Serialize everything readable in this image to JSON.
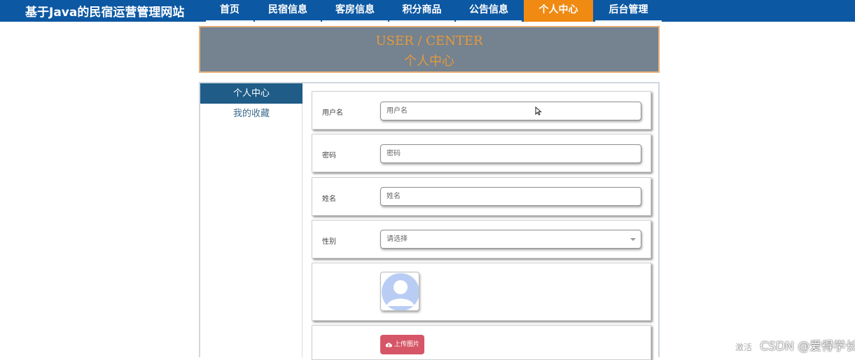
{
  "header": {
    "site_title": "基于Java的民宿运营管理网站",
    "nav": [
      {
        "label": "首页"
      },
      {
        "label": "民宿信息"
      },
      {
        "label": "客房信息"
      },
      {
        "label": "积分商品"
      },
      {
        "label": "公告信息"
      },
      {
        "label": "个人中心",
        "active": true
      },
      {
        "label": "后台管理"
      }
    ]
  },
  "banner": {
    "title_en": "USER / CENTER",
    "title_cn": "个人中心"
  },
  "sidebar": {
    "items": [
      {
        "label": "个人中心",
        "active": true
      },
      {
        "label": "我的收藏"
      }
    ]
  },
  "form": {
    "username": {
      "label": "用户名",
      "placeholder": "用户名"
    },
    "password": {
      "label": "密码",
      "placeholder": "密码"
    },
    "name": {
      "label": "姓名",
      "placeholder": "姓名"
    },
    "gender": {
      "label": "性别",
      "selected": "请选择"
    },
    "upload_label": "上传图片"
  },
  "watermark": {
    "activate": "激活",
    "text": "CSDN @爱得学长"
  },
  "colors": {
    "nav_bg": "#0c58a3",
    "nav_active": "#f08a13",
    "banner_bg": "#75828f",
    "banner_text": "#e49a3c",
    "sidebar_active": "#1f5c88",
    "upload_button": "#d65667"
  },
  "icons": {
    "avatar": "user-avatar-icon",
    "upload": "cloud-upload-icon",
    "select": "chevron-down-icon",
    "cursor": "mouse-cursor-icon"
  }
}
